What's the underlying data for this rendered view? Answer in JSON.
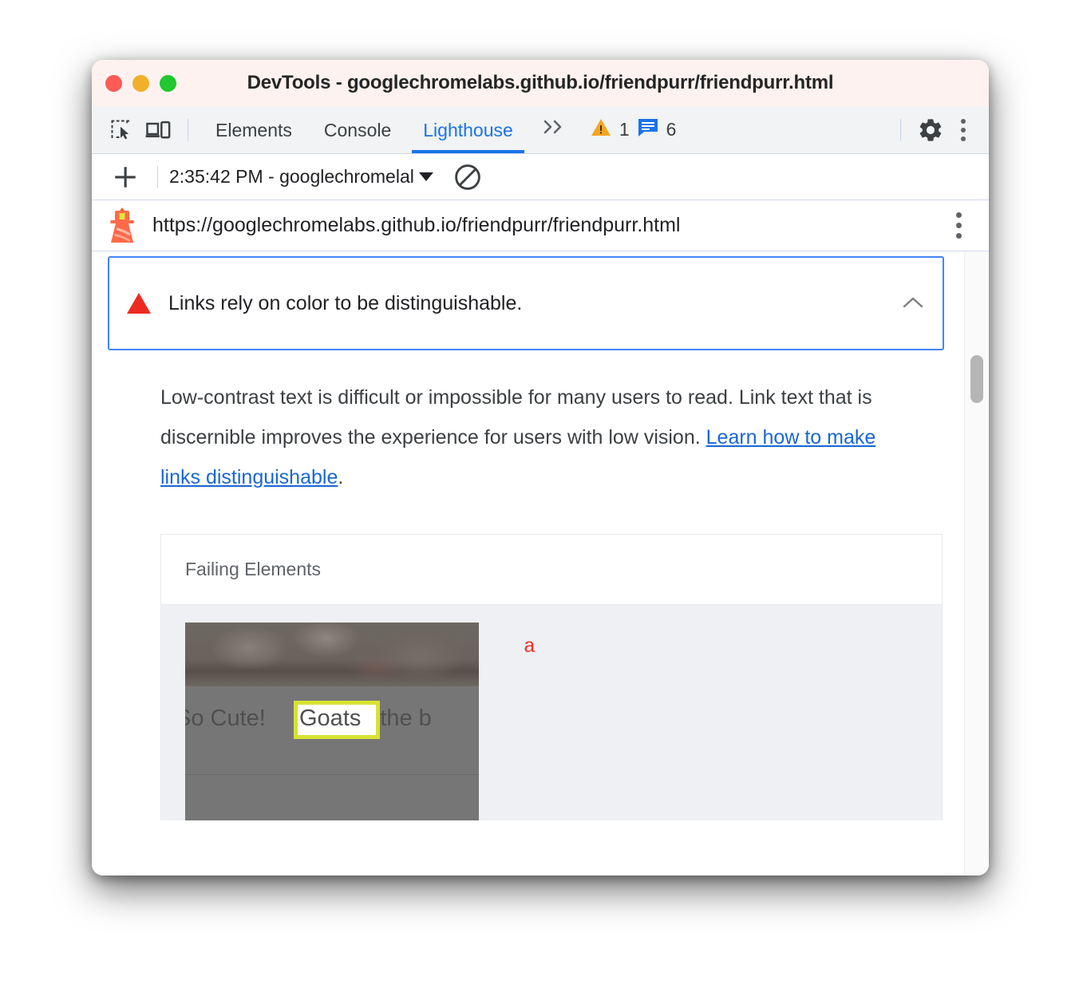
{
  "window": {
    "title": "DevTools - googlechromelabs.github.io/friendpurr/friendpurr.html",
    "traffic_lights": {
      "close": "close-button",
      "minimize": "minimize-button",
      "maximize": "maximize-button"
    }
  },
  "devtools_toolbar": {
    "inspect_icon": "inspect-element-icon",
    "device_icon": "device-toolbar-icon",
    "tabs": [
      {
        "label": "Elements",
        "active": false
      },
      {
        "label": "Console",
        "active": false
      },
      {
        "label": "Lighthouse",
        "active": true
      }
    ],
    "overflow_label": "»",
    "warning_count": "1",
    "message_count": "6",
    "settings_icon": "gear-icon",
    "more_icon": "kebab-menu-icon"
  },
  "lighthouse_toolbar": {
    "new_report_label": "+",
    "report_selected": "2:35:42 PM - googlechromelal",
    "clear_label": "clear-all-icon"
  },
  "url_bar": {
    "logo": "lighthouse-logo-icon",
    "url": "https://googlechromelabs.github.io/friendpurr/friendpurr.html",
    "menu_icon": "kebab-menu-icon"
  },
  "audit": {
    "status_icon": "fail-triangle-icon",
    "title": "Links rely on color to be distinguishable.",
    "collapse_icon": "chevron-up-icon",
    "description_part1": "Low-contrast text is difficult or impossible for many users to read. Link text that is discernible improves the experience for users with low vision. ",
    "description_link": "Learn how to make links distinguishable",
    "description_part2": "."
  },
  "details_table": {
    "header": "Failing Elements",
    "rows": [
      {
        "snippet_prefix": "So Cute! ",
        "snippet_highlight": "Goats",
        "snippet_suffix": " are the b",
        "node_selector": "a"
      }
    ]
  },
  "colors": {
    "accent_blue": "#1a73e8",
    "fail_red": "#ee2b20",
    "link_blue": "#1967d2",
    "highlight_yellow": "#d7e234",
    "titlebar_bg": "#fdf2ef",
    "toolbar_bg": "#f1f3f4",
    "row_bg": "#eef0f4"
  },
  "scrollbar": {
    "name": "vertical-scrollbar"
  }
}
